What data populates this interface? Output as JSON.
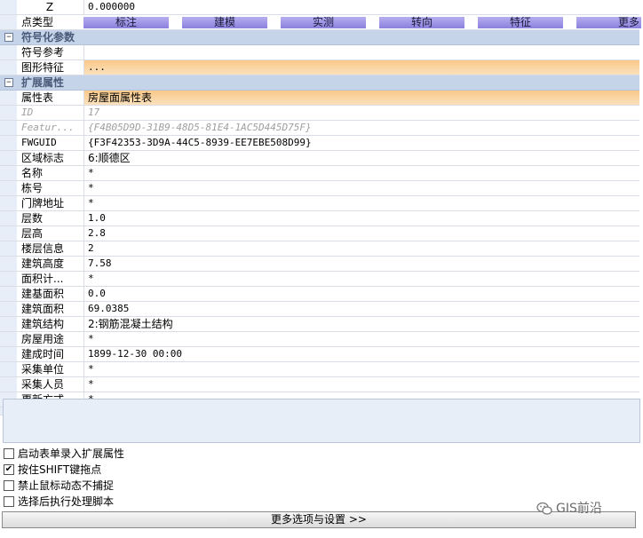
{
  "grid": {
    "z_row": {
      "name": "Z",
      "value": "0.000000"
    },
    "point_type": {
      "name": "点类型",
      "tabs": [
        "标注",
        "建模",
        "实测",
        "转向",
        "特征",
        "更多"
      ]
    },
    "categories": {
      "symbolization": "符号化参数",
      "extended": "扩展属性"
    },
    "symbol_rows": [
      {
        "name": "符号参考",
        "value": ""
      },
      {
        "name": "图形特征",
        "value": "..."
      }
    ],
    "attr_table": {
      "name": "属性表",
      "value": "房屋面属性表"
    },
    "attr_rows": [
      {
        "name": "ID",
        "value": "17"
      },
      {
        "name": "Featur...",
        "value": "{F4B05D9D-31B9-48D5-81E4-1AC5D445D75F}"
      },
      {
        "name": "FWGUID",
        "value": "{F3F42353-3D9A-44C5-8939-EE7EBE508D99}"
      },
      {
        "name": "区域标志",
        "value": "6:顺德区"
      },
      {
        "name": "名称",
        "value": "*"
      },
      {
        "name": "栋号",
        "value": "*"
      },
      {
        "name": "门牌地址",
        "value": "*"
      },
      {
        "name": "层数",
        "value": "1.0"
      },
      {
        "name": "层高",
        "value": "2.8"
      },
      {
        "name": "楼层信息",
        "value": "2"
      },
      {
        "name": "建筑高度",
        "value": "7.58"
      },
      {
        "name": "面积计...",
        "value": "*"
      },
      {
        "name": "建基面积",
        "value": "0.0"
      },
      {
        "name": "建筑面积",
        "value": "69.0385"
      },
      {
        "name": "建筑结构",
        "value": "2:钢筋混凝土结构"
      },
      {
        "name": "房屋用途",
        "value": "*"
      },
      {
        "name": "建成时间",
        "value": "1899-12-30 00:00"
      },
      {
        "name": "采集单位",
        "value": "*"
      },
      {
        "name": "采集人员",
        "value": "*"
      },
      {
        "name": "更新方式",
        "value": "*"
      }
    ]
  },
  "options": [
    {
      "label": "启动表单录入扩展属性",
      "checked": false
    },
    {
      "label": "按住SHIFT键拖点",
      "checked": true
    },
    {
      "label": "禁止鼠标动态不捕捉",
      "checked": false
    },
    {
      "label": "选择后执行处理脚本",
      "checked": false
    }
  ],
  "check_glyph": "✔",
  "more_button": "更多选项与设置 >>",
  "watermark": "GIS前沿"
}
